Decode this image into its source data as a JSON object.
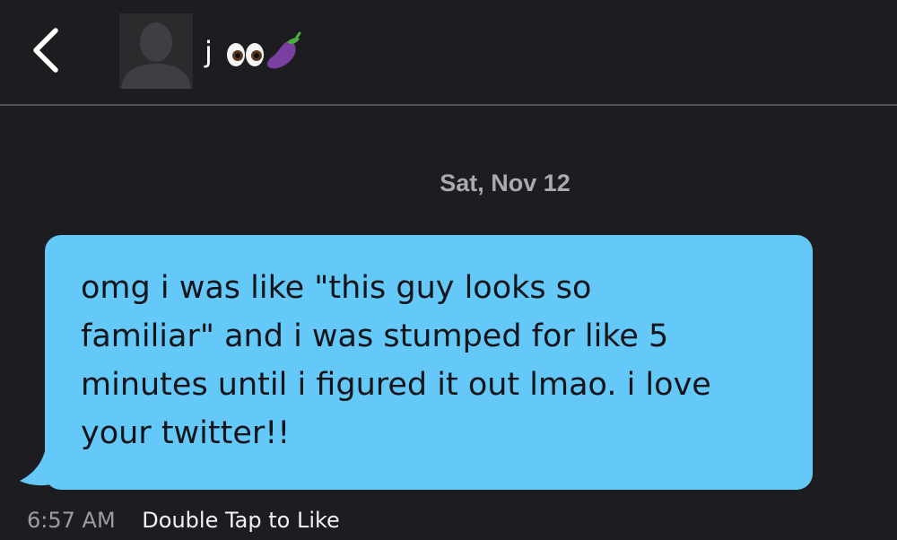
{
  "header": {
    "contact_name": "j",
    "name_emoji": [
      "eyes-emoji",
      "eggplant-emoji"
    ],
    "back_icon": "chevron-left-icon",
    "avatar_icon": "default-profile-silhouette"
  },
  "conversation": {
    "date_separator": "Sat, Nov 12",
    "messages": [
      {
        "text": "omg i was like \"this guy looks so\nfamiliar\" and i was stumped for like 5\nminutes until i figured it out lmao. i love\nyour twitter!!",
        "time": "6:57 AM",
        "action_hint": "Double Tap to Like",
        "bubble_color": "#64c9f8"
      }
    ]
  },
  "colors": {
    "background": "#1d1c21",
    "divider": "#505056",
    "bubble": "#64c9f8",
    "date_text": "#a9a9ae",
    "time_text": "#9c9ca2"
  }
}
